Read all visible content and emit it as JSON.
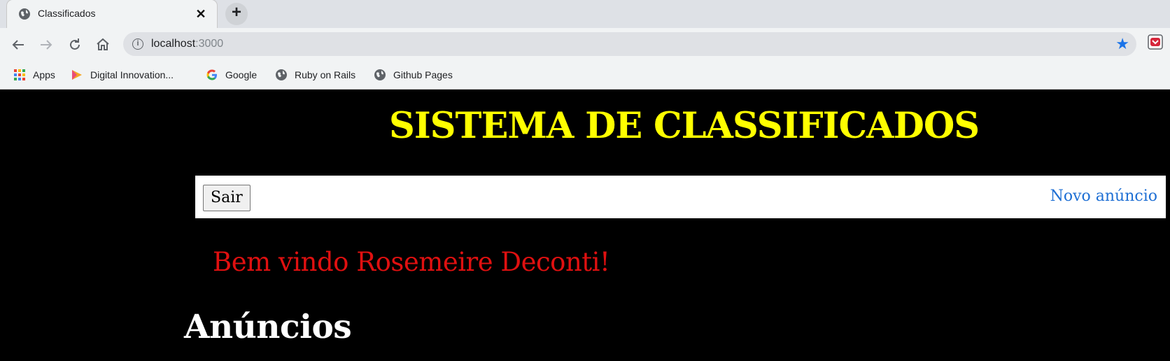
{
  "browser": {
    "tab": {
      "title": "Classificados",
      "close_glyph": "✕",
      "favicon": "globe-icon"
    },
    "new_tab_glyph": "+",
    "url": {
      "host": "localhost",
      "port": ":3000"
    },
    "bookmarks": [
      {
        "label": "Apps",
        "icon": "apps-grid-icon"
      },
      {
        "label": "Digital Innovation...",
        "icon": "play-logo-icon"
      },
      {
        "label": "Google",
        "icon": "google-g-icon"
      },
      {
        "label": "Ruby on Rails",
        "icon": "globe-icon"
      },
      {
        "label": "Github Pages",
        "icon": "globe-icon"
      }
    ],
    "colors": {
      "star": "#1a73e8"
    }
  },
  "page": {
    "title": "SISTEMA DE CLASSIFICADOS",
    "nav": {
      "logout_label": "Sair",
      "new_ad_link": "Novo anúncio"
    },
    "welcome": "Bem vindo Rosemeire Deconti!",
    "section_heading": "Anúncios",
    "colors": {
      "background": "#000000",
      "title": "#ffff00",
      "welcome": "#e01010",
      "link": "#1e6fd4",
      "heading": "#ffffff"
    }
  }
}
